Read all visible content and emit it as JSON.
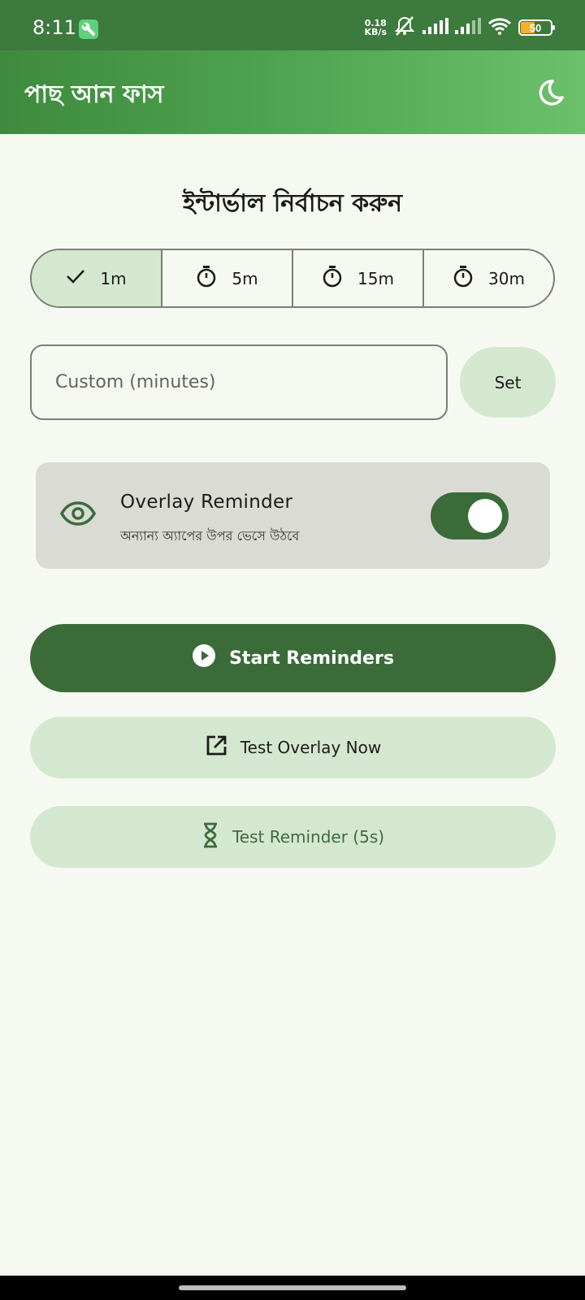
{
  "status_bar": {
    "time": "8:11",
    "net_speed_value": "0.18",
    "net_speed_unit": "KB/s",
    "battery_level": "50",
    "icons": [
      "wrench-icon",
      "mute-icon",
      "signal-icon",
      "signal-icon",
      "wifi-icon",
      "battery-icon"
    ]
  },
  "app_bar": {
    "title": "পাছ আন ফাস",
    "theme_icon": "moon-icon"
  },
  "interval": {
    "heading": "ইন্টার্ভাল নির্বাচন করুন",
    "options": [
      {
        "label": "1m",
        "icon": "check-icon",
        "selected": true
      },
      {
        "label": "5m",
        "icon": "timer-icon",
        "selected": false
      },
      {
        "label": "15m",
        "icon": "timer-icon",
        "selected": false
      },
      {
        "label": "30m",
        "icon": "timer-icon",
        "selected": false
      }
    ],
    "custom_placeholder": "Custom (minutes)",
    "custom_value": "",
    "set_label": "Set"
  },
  "overlay": {
    "icon": "eye-icon",
    "title": "Overlay Reminder",
    "subtitle": "অন্যান্য অ্যাপের উপর ভেসে উঠবে",
    "enabled": true
  },
  "actions": {
    "start_label": "Start Reminders",
    "test_overlay_label": "Test Overlay Now",
    "test_reminder_label": "Test Reminder (5s)"
  },
  "colors": {
    "primary": "#3b6b39",
    "primary_container": "#d4e8d0",
    "background": "#f6f9f1",
    "app_bar_start": "#3f8a3e",
    "app_bar_end": "#6cc06c"
  }
}
